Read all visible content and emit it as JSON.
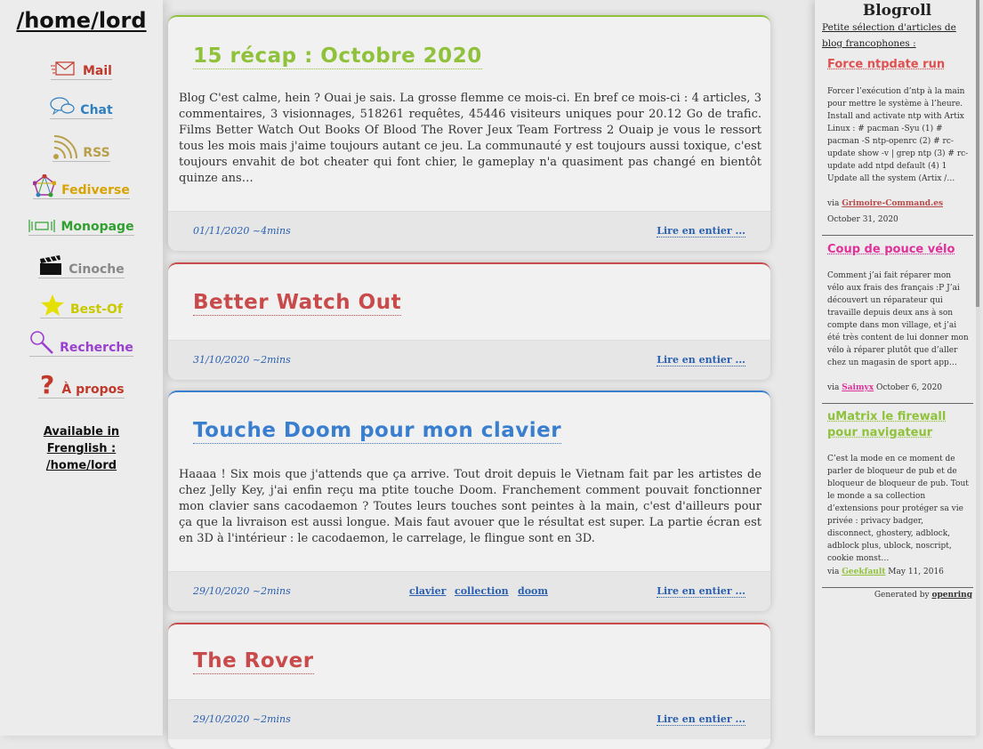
{
  "site": {
    "title": "/home/lord"
  },
  "nav": {
    "items": [
      {
        "label": "Mail",
        "color": "#c0392b",
        "icon": "mail-icon"
      },
      {
        "label": "Chat",
        "color": "#2f7fc1",
        "icon": "chat-bubbles-icon"
      },
      {
        "label": "RSS",
        "color": "#b8a04a",
        "icon": "rss-icon"
      },
      {
        "label": "Fediverse",
        "color": "#d9a400",
        "icon": "fediverse-icon"
      },
      {
        "label": "Monopage",
        "color": "#30a030",
        "icon": "monopage-icon"
      },
      {
        "label": "Cinoche",
        "color": "#888888",
        "icon": "clapperboard-icon"
      },
      {
        "label": "Best-Of",
        "color": "#c9c900",
        "icon": "star-icon"
      },
      {
        "label": "Recherche",
        "color": "#9a3fd0",
        "icon": "magnifier-icon"
      },
      {
        "label": "À propos",
        "color": "#c0392b",
        "icon": "question-mark-icon"
      }
    ],
    "available_line1": "Available in",
    "available_line2": "Frenglish :",
    "available_line3": "/home/lord"
  },
  "articles": [
    {
      "title": "15 récap : Octobre 2020",
      "title_color": "#8fc23a",
      "body": "Blog C'est calme, hein ? Ouai je sais. La grosse flemme ce mois-ci. En bref ce mois-ci : 4 articles, 3 commentaires, 3 visionnages, 518261 requêtes, 45446 visiteurs uniques pour 20.12 Go de trafic. Films Better Watch Out Books Of Blood The Rover Jeux Team Fortress 2 Ouaip je vous le ressort tous les mois mais j'aime toujours autant ce jeu. La communauté y est toujours aussi toxique, c'est toujours envahit de bot cheater qui font chier, le gameplay n'a quasiment pas changé en bientôt quinze ans…",
      "date": "01/11/2020 ~4mins",
      "more": "Lire en entier ..."
    },
    {
      "title": "Better Watch Out",
      "title_color": "#c84a4a",
      "date": "31/10/2020 ~2mins",
      "more": "Lire en entier ..."
    },
    {
      "title": "Touche Doom pour mon clavier",
      "title_color": "#3a7fcf",
      "body": "Haaaa ! Six mois que j'attends que ça arrive. Tout droit depuis le Vietnam fait par les artistes de chez Jelly Key, j'ai enfin reçu ma ptite touche Doom. Franchement comment pouvait fonctionner mon clavier sans cacodaemon ? Toutes leurs touches sont peintes à la main, c'est d'ailleurs pour ça que la livraison est aussi longue. Mais faut avouer que le résultat est super. La partie écran est en 3D à l'intérieur : le cacodaemon, le carrelage, le flingue sont en 3D.",
      "date": "29/10/2020 ~2mins",
      "tags": [
        "clavier",
        "collection",
        "doom"
      ],
      "more": "Lire en entier ..."
    },
    {
      "title": "The Rover",
      "title_color": "#c84a4a",
      "date": "29/10/2020 ~2mins",
      "more": "Lire en entier ..."
    }
  ],
  "blogroll": {
    "title": "Blogroll",
    "subtitle": "Petite sélection d'articles de blog francophones :",
    "entries": [
      {
        "title": "Force ntpdate run",
        "title_color": "#e05050",
        "excerpt": "Forcer l’exécution d’ntp à la main pour mettre le système à l’heure. Install and activate ntp with Artix Linux : # pacman -Syu (1) # pacman -S ntp-openrc (2) # rc-update show -v | grep ntp (3) # rc-update add ntpd default (4) 1 Update all the system (Artix /…",
        "via": "via",
        "source": "Grimoire-Command.es",
        "source_color": "#b84a4a",
        "date": "October 31, 2020"
      },
      {
        "title": "Coup de pouce vélo",
        "title_color": "#e0309a",
        "excerpt": "Comment j’ai fait réparer mon vélo aux frais des français :P J’ai découvert un réparateur qui travaille depuis deux ans à son compte dans mon village, et j’ai été très content de lui donner mon vélo à réparer plutôt que d’aller chez un magasin de sport app…",
        "via": "via",
        "source": "Saimyx",
        "source_color": "#e0309a",
        "date": "October 6, 2020"
      },
      {
        "title": "uMatrix le firewall pour navigateur",
        "title_color": "#8fc23a",
        "excerpt": "C’est la mode en ce moment de parler de bloqueur de pub et de bloqueur de bloqueur de pub. Tout le monde a sa collection d’extensions pour protéger sa vie privée : privacy badger, disconnect, ghostery, adblock, adblock plus, ublock, noscript, cookie monst…",
        "via": "via",
        "source": "Geekfault",
        "source_color": "#8fc23a",
        "date": "May 11, 2016"
      }
    ],
    "generated_prefix": "Generated by",
    "generated_tool": "openring"
  }
}
